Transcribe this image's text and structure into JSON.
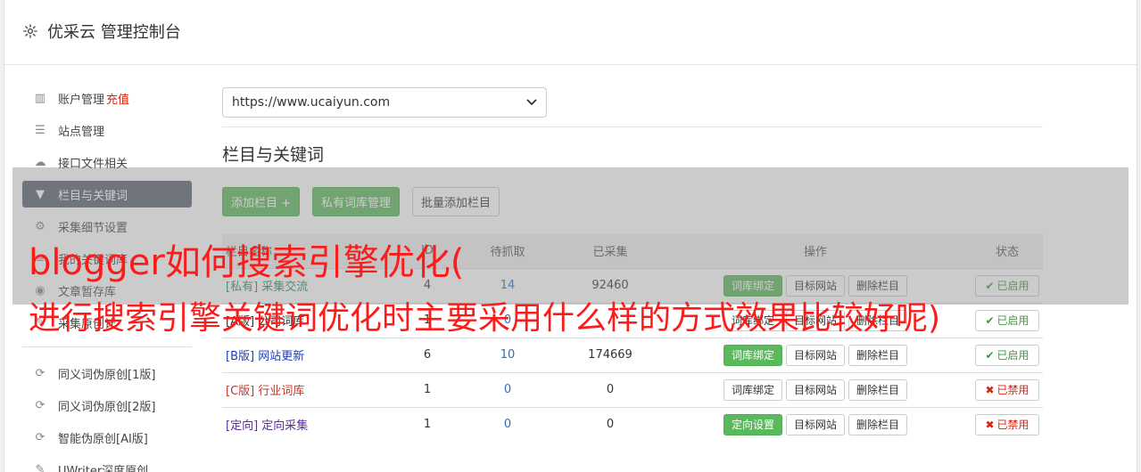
{
  "header": {
    "title": "优采云 管理控制台"
  },
  "sidebar": {
    "items": [
      {
        "label": "账户管理",
        "extra": "充值",
        "icon": "bar-chart-icon",
        "active": false
      },
      {
        "label": "站点管理",
        "icon": "server-icon",
        "active": false
      },
      {
        "label": "接口文件相关",
        "icon": "cloud-upload-icon",
        "active": false
      },
      {
        "label": "栏目与关键词",
        "icon": "filter-icon",
        "active": true
      },
      {
        "label": "采集细节设置",
        "icon": "cogs-icon",
        "active": false
      },
      {
        "label": "我的关键词库",
        "icon": "list-icon",
        "active": false
      },
      {
        "label": "文章暂存库",
        "icon": "database-icon",
        "active": false
      },
      {
        "label": "采集原创计",
        "icon": "pencil-icon",
        "active": false
      }
    ],
    "items2": [
      {
        "label": "同义词伪原创[1版]",
        "icon": "refresh-icon"
      },
      {
        "label": "同义词伪原创[2版]",
        "icon": "refresh-icon"
      },
      {
        "label": "智能伪原创[AI版]",
        "icon": "refresh-icon"
      },
      {
        "label": "UWriter深度原创",
        "icon": "edit-icon"
      }
    ]
  },
  "main": {
    "site_select": "https://www.ucaiyun.com",
    "section_title": "栏目与关键词",
    "buttons": {
      "add_column": "添加栏目 +",
      "private_lib": "私有词库管理",
      "batch_add": "批量添加栏目"
    },
    "table": {
      "headers": [
        "栏目名称",
        "ID",
        "待抓取",
        "已采集",
        "操作",
        "状态"
      ],
      "rows": [
        {
          "tag": "[私有]",
          "name": "采集交流",
          "id": "4",
          "pending": "14",
          "collected": "92460",
          "op1": "词库绑定",
          "op2": "目标网站",
          "op3": "删除栏目",
          "status": "已启用",
          "status_on": true,
          "tag_class": "tag-private",
          "op1_green": true
        },
        {
          "tag": "[A版]",
          "name": "公司词库",
          "id": "1",
          "pending": "0",
          "collected": "",
          "op1": "词库绑定",
          "op2": "目标网站",
          "op3": "删除栏目",
          "status": "已启用",
          "status_on": true,
          "tag_class": "tag-public",
          "op1_green": false
        },
        {
          "tag": "[B版]",
          "name": "网站更新",
          "id": "6",
          "pending": "10",
          "collected": "174669",
          "op1": "词库绑定",
          "op2": "目标网站",
          "op3": "删除栏目",
          "status": "已启用",
          "status_on": true,
          "tag_class": "tag-b",
          "op1_green": true
        },
        {
          "tag": "[C版]",
          "name": "行业词库",
          "id": "1",
          "pending": "0",
          "collected": "0",
          "op1": "词库绑定",
          "op2": "目标网站",
          "op3": "删除栏目",
          "status": "已禁用",
          "status_on": false,
          "tag_class": "tag-c",
          "op1_green": false
        },
        {
          "tag": "[定向]",
          "name": "定向采集",
          "id": "1",
          "pending": "0",
          "collected": "0",
          "op1": "定向设置",
          "op2": "目标网站",
          "op3": "删除栏目",
          "status": "已禁用",
          "status_on": false,
          "tag_class": "tag-d",
          "op1_green": true
        }
      ]
    }
  },
  "overlay": {
    "line1": "blogger如何搜索引擎优化(",
    "line2": "进行搜索引擎关键词优化时主要采用什么样的方式效果比较好呢)"
  },
  "colors": {
    "green": "#5cb85c",
    "active_nav": "#5a6270",
    "red_text": "#ff1a1a"
  }
}
